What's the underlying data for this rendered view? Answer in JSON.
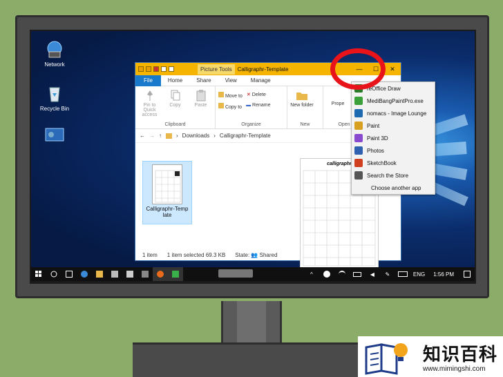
{
  "desktop": {
    "icons": [
      {
        "label": "Network"
      },
      {
        "label": "Recycle Bin"
      },
      {
        "label": ""
      }
    ]
  },
  "window": {
    "context_tab": "Picture Tools",
    "title": "Calligraphr-Template",
    "controls": {
      "minimize": "—",
      "maximize": "☐",
      "close": "✕"
    },
    "tabs": [
      "File",
      "Home",
      "Share",
      "View",
      "Manage"
    ],
    "ribbon": {
      "clipboard": {
        "label": "Clipboard",
        "pin": "Pin to Quick access",
        "copy": "Copy",
        "paste": "Paste"
      },
      "organize": {
        "label": "Organize",
        "move_to": "Move to",
        "copy_to": "Copy to",
        "delete": "Delete",
        "rename": "Rename"
      },
      "new": {
        "label": "New",
        "new_folder": "New folder"
      },
      "open": {
        "label": "Open",
        "properties": "Prope"
      }
    },
    "address": {
      "segments": [
        "Downloads",
        "Calligraphr-Template"
      ]
    },
    "file": {
      "name": "Calligraphr-Template"
    },
    "preview_title": "calligraphr",
    "status": {
      "count": "1 item",
      "selected": "1 item selected  69.3 KB",
      "state": "State: 👥 Shared"
    }
  },
  "open_with_menu": {
    "items": [
      {
        "label": "reOffice Draw",
        "icon": "draw-icon",
        "color": "#2a7a2a"
      },
      {
        "label": "MediBangPaintPro.exe",
        "icon": "medibang-icon",
        "color": "#3aa03a"
      },
      {
        "label": "nomacs - Image Lounge",
        "icon": "nomacs-icon",
        "color": "#1e6ab0"
      },
      {
        "label": "Paint",
        "icon": "paint-icon",
        "color": "#d8a020"
      },
      {
        "label": "Paint 3D",
        "icon": "paint3d-icon",
        "color": "#8a4ad0"
      },
      {
        "label": "Photos",
        "icon": "photos-icon",
        "color": "#3060b0"
      },
      {
        "label": "SketchBook",
        "icon": "sketchbook-icon",
        "color": "#d04020"
      },
      {
        "label": "Search the Store",
        "icon": "store-icon",
        "color": "#555555"
      },
      {
        "label": "Choose another app",
        "icon": "",
        "color": ""
      }
    ]
  },
  "taskbar": {
    "language": "ENG",
    "time": "1:56 PM"
  },
  "watermark": {
    "text": "知识百科",
    "url": "www.mimingshi.com"
  },
  "colors": {
    "wall": "#8cac6a",
    "highlight_circle": "#e8141a",
    "file_tab": "#1979ca",
    "title_bar": "#f4b400"
  }
}
